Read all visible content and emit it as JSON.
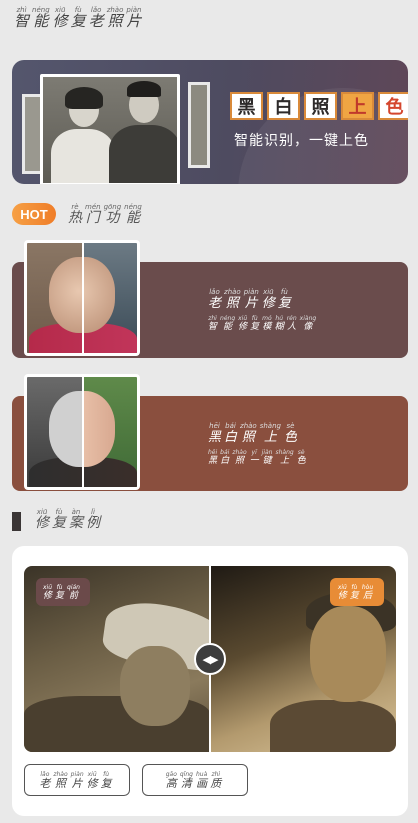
{
  "page_title": [
    {
      "p": "zhì",
      "h": "智"
    },
    {
      "p": "néng",
      "h": "能"
    },
    {
      "p": "xiū",
      "h": "修"
    },
    {
      "p": "fù",
      "h": "复"
    },
    {
      "p": "lǎo",
      "h": "老"
    },
    {
      "p": "zhào",
      "h": "照"
    },
    {
      "p": "piàn",
      "h": "片"
    }
  ],
  "banner": {
    "chars": [
      "黑",
      "白",
      "照",
      "上",
      "色"
    ],
    "subtitle": "智能识别，一键上色"
  },
  "hot": {
    "badge": "HOT",
    "title": [
      {
        "p": "rè",
        "h": "热"
      },
      {
        "p": "mén",
        "h": "门"
      },
      {
        "p": "gōng",
        "h": "功"
      },
      {
        "p": "néng",
        "h": "能"
      }
    ]
  },
  "features": [
    {
      "title": [
        {
          "p": "lǎo",
          "h": "老"
        },
        {
          "p": "zhào",
          "h": "照"
        },
        {
          "p": "piàn",
          "h": "片"
        },
        {
          "p": "xiū",
          "h": "修"
        },
        {
          "p": "fù",
          "h": "复"
        }
      ],
      "desc": [
        {
          "p": "zhì",
          "h": "智"
        },
        {
          "p": "néng",
          "h": "能"
        },
        {
          "p": "xiū",
          "h": "修"
        },
        {
          "p": "fù",
          "h": "复"
        },
        {
          "p": "mó",
          "h": "模"
        },
        {
          "p": "hú",
          "h": "糊"
        },
        {
          "p": "rén",
          "h": "人"
        },
        {
          "p": "xiàng",
          "h": "像"
        }
      ]
    },
    {
      "title": [
        {
          "p": "hēi",
          "h": "黑"
        },
        {
          "p": "bái",
          "h": "白"
        },
        {
          "p": "zhào",
          "h": "照"
        },
        {
          "p": "shàng",
          "h": "上"
        },
        {
          "p": "sè",
          "h": "色"
        }
      ],
      "desc": [
        {
          "p": "hēi",
          "h": "黑"
        },
        {
          "p": "bái",
          "h": "白"
        },
        {
          "p": "zhào",
          "h": "照"
        },
        {
          "p": "yī",
          "h": "一"
        },
        {
          "p": "jiàn",
          "h": "键"
        },
        {
          "p": "shàng",
          "h": "上"
        },
        {
          "p": "sè",
          "h": "色"
        }
      ]
    }
  ],
  "cases": {
    "title": [
      {
        "p": "xiū",
        "h": "修"
      },
      {
        "p": "fù",
        "h": "复"
      },
      {
        "p": "àn",
        "h": "案"
      },
      {
        "p": "lì",
        "h": "例"
      }
    ],
    "before_tag": [
      {
        "p": "xiū",
        "h": "修"
      },
      {
        "p": "fù",
        "h": "复"
      },
      {
        "p": "qián",
        "h": "前"
      }
    ],
    "after_tag": [
      {
        "p": "xiū",
        "h": "修"
      },
      {
        "p": "fù",
        "h": "复"
      },
      {
        "p": "hòu",
        "h": "后"
      }
    ],
    "tabs": [
      [
        {
          "p": "lǎo",
          "h": "老"
        },
        {
          "p": "zhào",
          "h": "照"
        },
        {
          "p": "piàn",
          "h": "片"
        },
        {
          "p": "xiū",
          "h": "修"
        },
        {
          "p": "fù",
          "h": "复"
        }
      ],
      [
        {
          "p": "gāo",
          "h": "高"
        },
        {
          "p": "qīng",
          "h": "清"
        },
        {
          "p": "huà",
          "h": "画"
        },
        {
          "p": "zhì",
          "h": "质"
        }
      ]
    ]
  }
}
